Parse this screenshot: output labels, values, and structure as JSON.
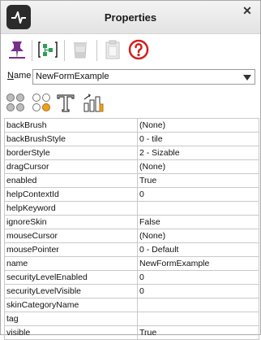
{
  "window": {
    "title": "Properties",
    "close_glyph": "✕",
    "app_icon": "waveform-icon"
  },
  "toolbar": {
    "buttons": [
      {
        "icon": "pin-icon",
        "enabled": true
      },
      {
        "icon": "component-tree-icon",
        "enabled": true
      },
      {
        "icon": "clear-icon",
        "enabled": false
      },
      {
        "icon": "paste-icon",
        "enabled": false
      },
      {
        "icon": "help-icon",
        "enabled": true
      }
    ]
  },
  "name_selector": {
    "label_underlined": "N",
    "label_rest": "ame",
    "value": "NewFormExample"
  },
  "view_toolbar": {
    "buttons": [
      {
        "icon": "show-all-properties-icon"
      },
      {
        "icon": "show-modified-properties-icon"
      },
      {
        "icon": "text-properties-icon"
      },
      {
        "icon": "sort-properties-icon"
      }
    ]
  },
  "properties": [
    {
      "name": "backBrush",
      "value": "(None)"
    },
    {
      "name": "backBrushStyle",
      "value": "0 - tile"
    },
    {
      "name": "borderStyle",
      "value": "2 - Sizable"
    },
    {
      "name": "dragCursor",
      "value": "(None)"
    },
    {
      "name": "enabled",
      "value": "True"
    },
    {
      "name": "helpContextId",
      "value": "0"
    },
    {
      "name": "helpKeyword",
      "value": ""
    },
    {
      "name": "ignoreSkin",
      "value": "False"
    },
    {
      "name": "mouseCursor",
      "value": "(None)"
    },
    {
      "name": "mousePointer",
      "value": " 0 - Default"
    },
    {
      "name": "name",
      "value": "NewFormExample"
    },
    {
      "name": "securityLevelEnabled",
      "value": "0"
    },
    {
      "name": "securityLevelVisible",
      "value": "0"
    },
    {
      "name": "skinCategoryName",
      "value": ""
    },
    {
      "name": "tag",
      "value": ""
    },
    {
      "name": "visible",
      "value": "True"
    }
  ],
  "colors": {
    "pin": "#7b2d8e",
    "component_tree": "#2e9e5a",
    "help": "#d0201c",
    "modified_dot": "#f0a020"
  }
}
